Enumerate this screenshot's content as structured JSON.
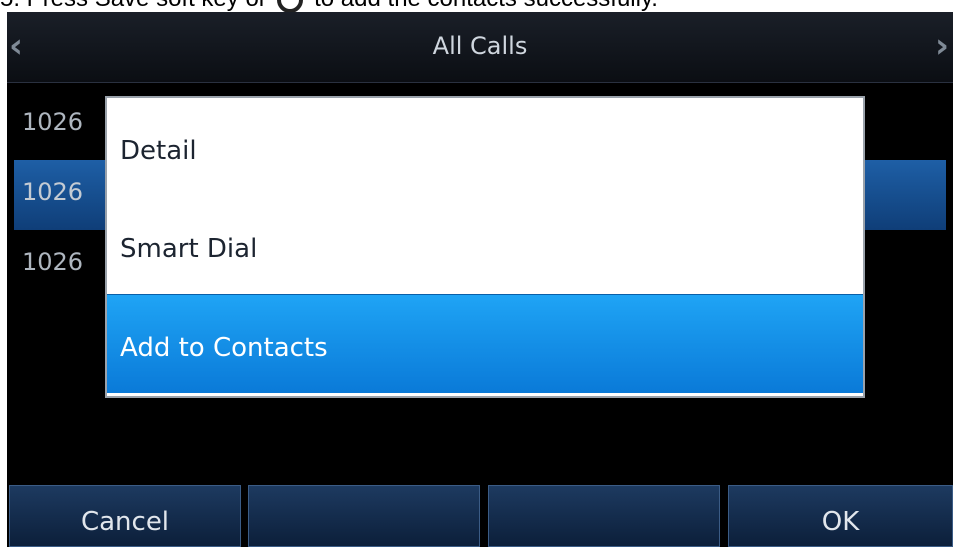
{
  "caption": {
    "text_before": "5. Press Save soft key or",
    "text_after": "to add the contacts successfully."
  },
  "titlebar": {
    "title": "All Calls"
  },
  "calls": [
    {
      "number": "1026"
    },
    {
      "number": "1026"
    },
    {
      "number": "1026"
    }
  ],
  "menu": {
    "items": [
      {
        "label": "Detail"
      },
      {
        "label": "Smart Dial"
      },
      {
        "label": "Add to Contacts"
      }
    ]
  },
  "softkeys": {
    "key1": "Cancel",
    "key2": "",
    "key3": "",
    "key4": "OK"
  }
}
